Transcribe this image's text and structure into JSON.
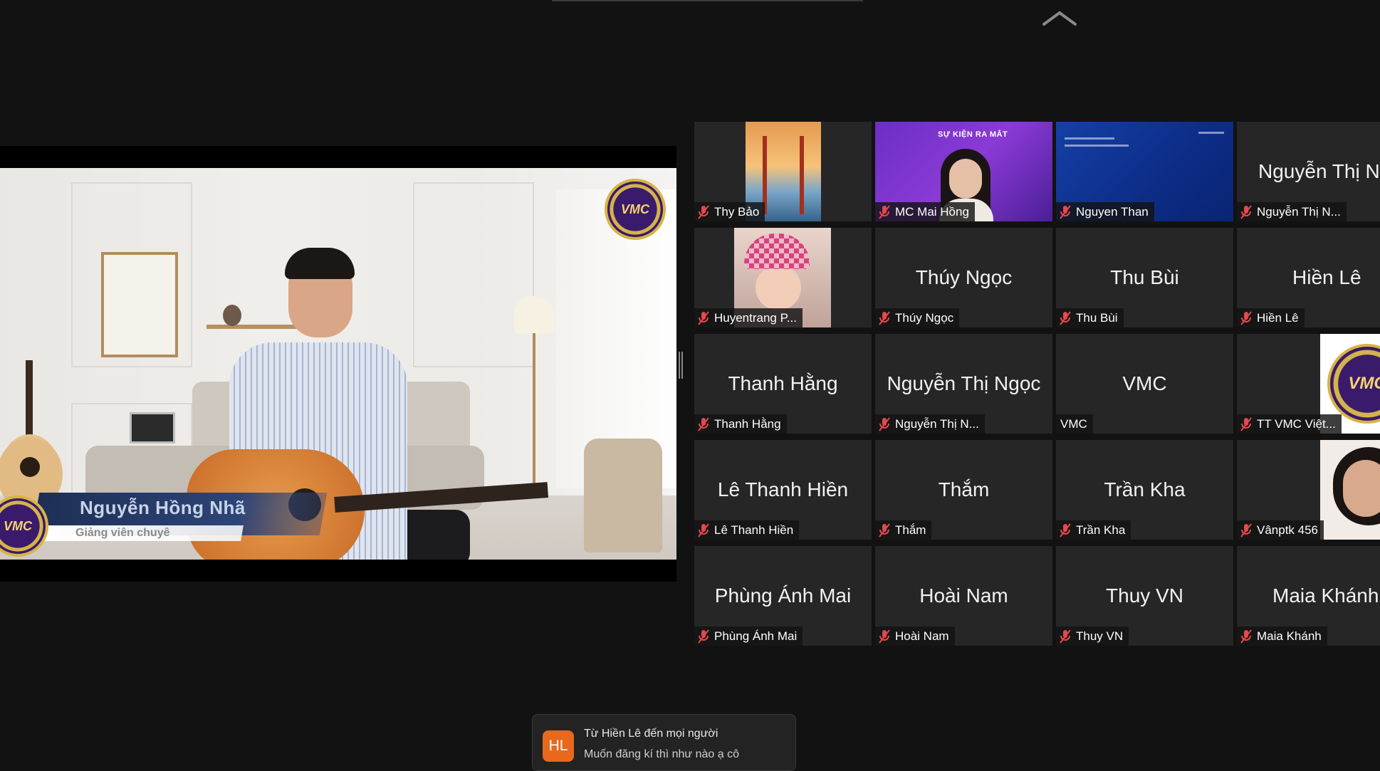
{
  "share": {
    "lower_third_name": "Nguyễn Hồng Nhã",
    "lower_third_title": "Giảng viên chuyê",
    "logo_text": "VMC"
  },
  "gallery": {
    "tiles": [
      {
        "center_name": "",
        "label": "Thy Bảo",
        "thumb": "bridge-photo"
      },
      {
        "center_name": "",
        "label": "MC Mai Hồng",
        "thumb": "mc-video",
        "active": true,
        "banner": "SỰ KIỆN RA MẮT"
      },
      {
        "center_name": "",
        "label": "Nguyen Than",
        "thumb": "blue-slide"
      },
      {
        "center_name": "Nguyễn Thị N",
        "label": "Nguyễn Thị N..."
      },
      {
        "center_name": "",
        "label": "Huyentrang P...",
        "thumb": "baby-photo"
      },
      {
        "center_name": "Thúy Ngọc",
        "label": "Thúy Ngọc"
      },
      {
        "center_name": "Thu Bùi",
        "label": "Thu Bùi"
      },
      {
        "center_name": "Hiền Lê",
        "label": "Hiền Lê"
      },
      {
        "center_name": "Thanh Hằng",
        "label": "Thanh Hằng"
      },
      {
        "center_name": "Nguyễn Thị Ngọc",
        "label": "Nguyễn Thị N..."
      },
      {
        "center_name": "VMC",
        "label": "VMC"
      },
      {
        "center_name": "",
        "label": "TT VMC Việt...",
        "thumb": "vmc-logo"
      },
      {
        "center_name": "Lê Thanh Hiền",
        "label": "Lê Thanh Hiền"
      },
      {
        "center_name": "Thắm",
        "label": "Thắm"
      },
      {
        "center_name": "Trần Kha",
        "label": "Trần Kha"
      },
      {
        "center_name": "",
        "label": "Vânptk 456",
        "thumb": "woman-photo"
      },
      {
        "center_name": "Phùng Ánh Mai",
        "label": "Phùng Ánh Mai"
      },
      {
        "center_name": "Hoài Nam",
        "label": "Hoài Nam"
      },
      {
        "center_name": "Thuy VN",
        "label": "Thuy VN"
      },
      {
        "center_name": "Maia Khánh",
        "label": "Maia Khánh"
      }
    ]
  },
  "chat": {
    "avatar_initials": "HL",
    "from": "Từ Hiền Lê đến mọi người",
    "message": "Muốn đăng kí thì như nào ạ cô"
  },
  "colors": {
    "background": "#121212",
    "tile": "#262626",
    "active_speaker_border": "#d7e283",
    "mic_off": "#e5484d",
    "chat_avatar": "#e8681e"
  }
}
